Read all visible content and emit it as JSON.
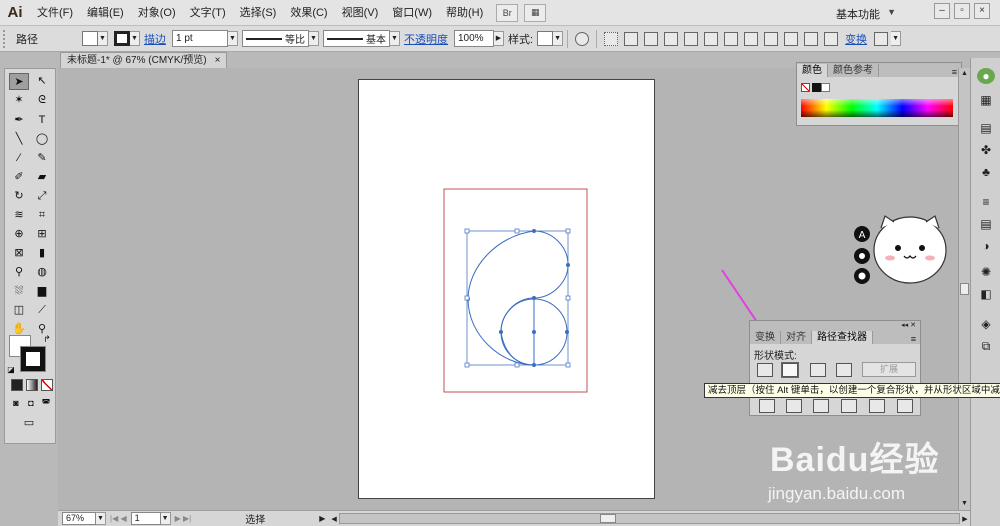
{
  "app": {
    "logo": "Ai"
  },
  "menu": [
    "文件(F)",
    "编辑(E)",
    "对象(O)",
    "文字(T)",
    "选择(S)",
    "效果(C)",
    "视图(V)",
    "窗口(W)",
    "帮助(H)"
  ],
  "menubar": {
    "bridge_label": "Br",
    "workspace": "基本功能"
  },
  "control": {
    "object_type": "路径",
    "stroke_link": "描边",
    "stroke_weight": "1 pt",
    "profile_label": "等比",
    "brush_label": "基本",
    "opacity_link": "不透明度",
    "opacity_value": "100%",
    "style_label": "样式:",
    "transform_link": "变换"
  },
  "document": {
    "tab_title": "未标题-1* @ 67% (CMYK/预览)",
    "close": "×"
  },
  "panels": {
    "color": {
      "tabs": [
        "颜色",
        "颜色参考"
      ]
    },
    "pathfinder": {
      "tabs": [
        "变换",
        "对齐",
        "路径查找器"
      ],
      "shape_modes_label": "形状模式:",
      "expand_label": "扩展",
      "tooltip": "减去顶层（按住 Alt 键单击，以创建一个复合形状，并从形状区域中减去）"
    }
  },
  "statusbar": {
    "zoom": "67%",
    "page": "1",
    "tool": "选择"
  },
  "watermark": {
    "main": "Baidu经验",
    "sub": "jingyan.baidu.com"
  },
  "colors": {
    "accent": "#e040e0",
    "artboard_guide": "#c0504d",
    "path": "#3a6ec0"
  }
}
